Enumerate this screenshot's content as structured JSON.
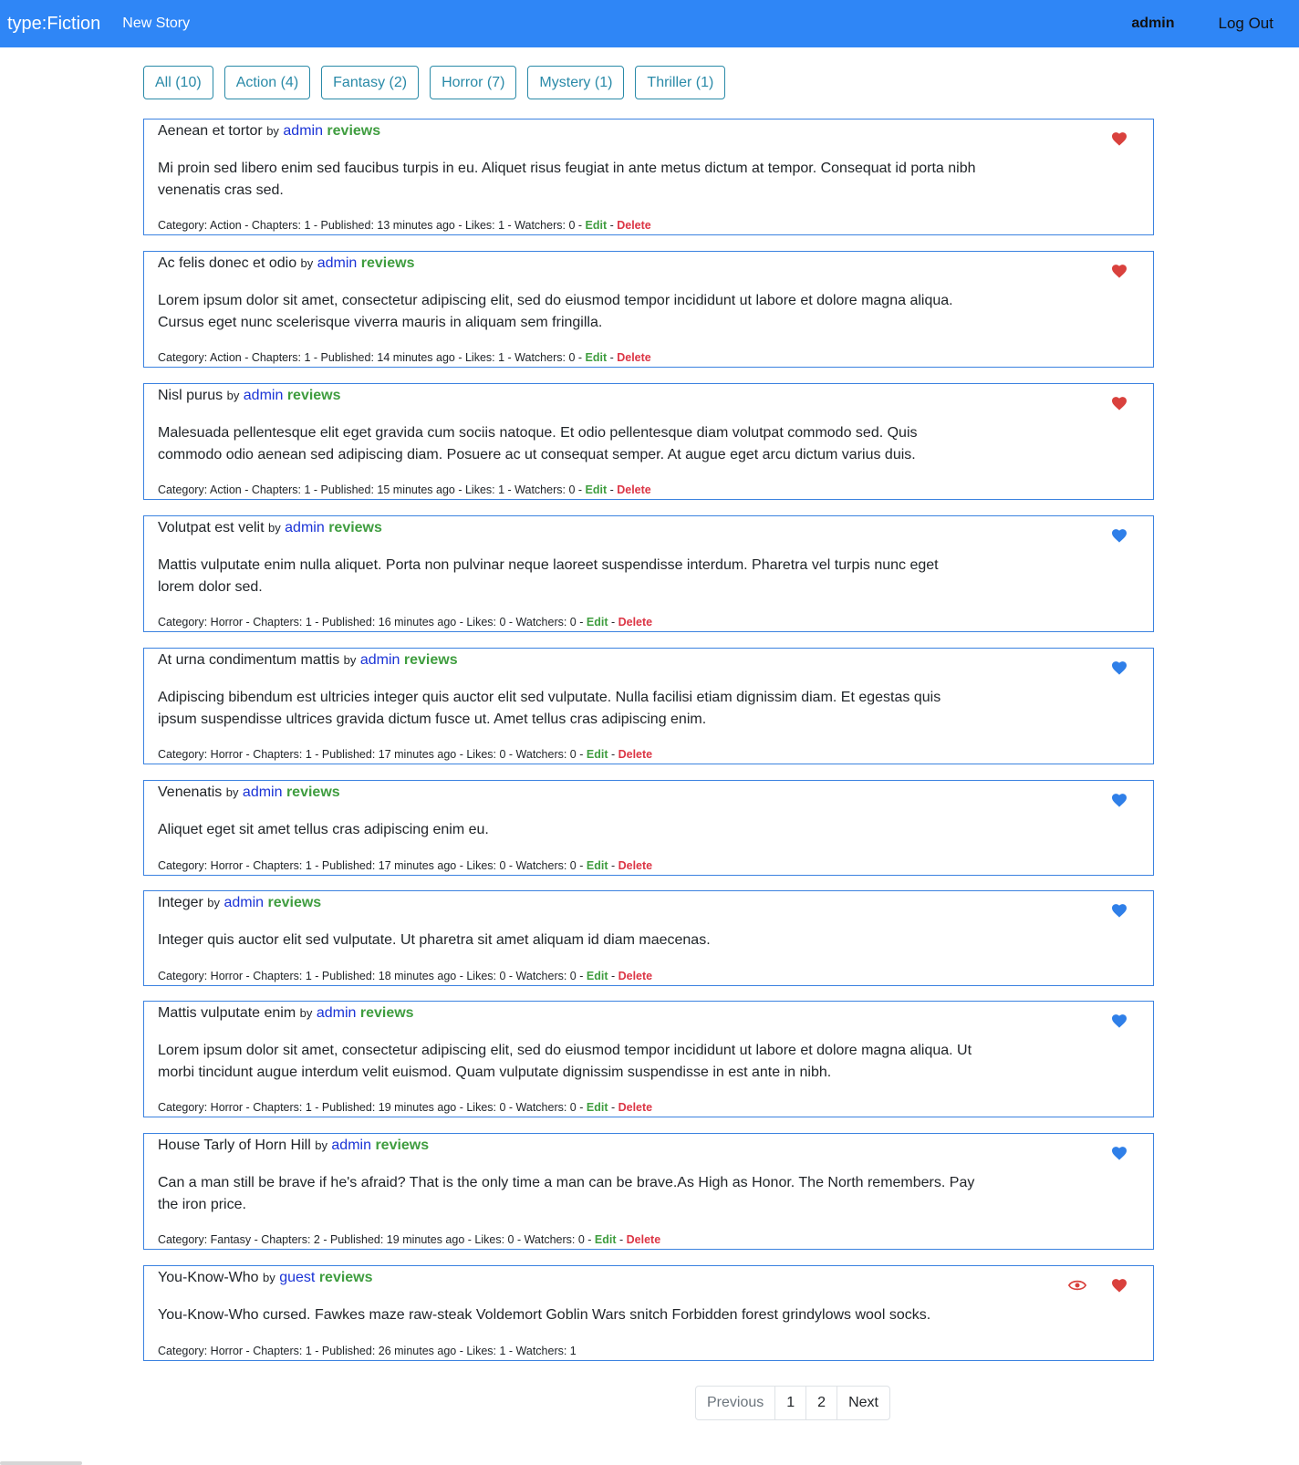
{
  "nav": {
    "brand": "type:Fiction",
    "new_story": "New Story",
    "user": "admin",
    "logout": "Log Out"
  },
  "filters": [
    "All (10)",
    "Action (4)",
    "Fantasy (2)",
    "Horror (7)",
    "Mystery (1)",
    "Thriller (1)"
  ],
  "labels": {
    "by": "by",
    "reviews": "reviews",
    "edit": "Edit",
    "delete": "Delete"
  },
  "colors": {
    "navbar": "#2f86f6",
    "heart_liked": "#d9413d",
    "heart_unliked": "#2f7fe8",
    "eye_watched": "#d9413d"
  },
  "stories": [
    {
      "title": "Aenean et tortor",
      "author": "admin",
      "desc": "Mi proin sed libero enim sed faucibus turpis in eu. Aliquet risus feugiat in ante metus dictum at tempor. Consequat id porta nibh venenatis cras sed.",
      "meta": "Category: Action - Chapters: 1 - Published: 13 minutes ago - Likes: 1 - Watchers: 0",
      "liked": true,
      "watched": false,
      "editable": true
    },
    {
      "title": "Ac felis donec et odio",
      "author": "admin",
      "desc": "Lorem ipsum dolor sit amet, consectetur adipiscing elit, sed do eiusmod tempor incididunt ut labore et dolore magna aliqua. Cursus eget nunc scelerisque viverra mauris in aliquam sem fringilla.",
      "meta": "Category: Action - Chapters: 1 - Published: 14 minutes ago - Likes: 1 - Watchers: 0",
      "liked": true,
      "watched": false,
      "editable": true
    },
    {
      "title": "Nisl purus",
      "author": "admin",
      "desc": "Malesuada pellentesque elit eget gravida cum sociis natoque. Et odio pellentesque diam volutpat commodo sed. Quis commodo odio aenean sed adipiscing diam. Posuere ac ut consequat semper. At augue eget arcu dictum varius duis.",
      "meta": "Category: Action - Chapters: 1 - Published: 15 minutes ago - Likes: 1 - Watchers: 0",
      "liked": true,
      "watched": false,
      "editable": true
    },
    {
      "title": "Volutpat est velit",
      "author": "admin",
      "desc": "Mattis vulputate enim nulla aliquet. Porta non pulvinar neque laoreet suspendisse interdum. Pharetra vel turpis nunc eget lorem dolor sed.",
      "meta": "Category: Horror - Chapters: 1 - Published: 16 minutes ago - Likes: 0 - Watchers: 0",
      "liked": false,
      "watched": false,
      "editable": true
    },
    {
      "title": "At urna condimentum mattis",
      "author": "admin",
      "desc": "Adipiscing bibendum est ultricies integer quis auctor elit sed vulputate. Nulla facilisi etiam dignissim diam. Et egestas quis ipsum suspendisse ultrices gravida dictum fusce ut. Amet tellus cras adipiscing enim.",
      "meta": "Category: Horror - Chapters: 1 - Published: 17 minutes ago - Likes: 0 - Watchers: 0",
      "liked": false,
      "watched": false,
      "editable": true
    },
    {
      "title": "Venenatis",
      "author": "admin",
      "desc": "Aliquet eget sit amet tellus cras adipiscing enim eu.",
      "meta": "Category: Horror - Chapters: 1 - Published: 17 minutes ago - Likes: 0 - Watchers: 0",
      "liked": false,
      "watched": false,
      "editable": true
    },
    {
      "title": "Integer",
      "author": "admin",
      "desc": "Integer quis auctor elit sed vulputate. Ut pharetra sit amet aliquam id diam maecenas.",
      "meta": "Category: Horror - Chapters: 1 - Published: 18 minutes ago - Likes: 0 - Watchers: 0",
      "liked": false,
      "watched": false,
      "editable": true
    },
    {
      "title": "Mattis vulputate enim",
      "author": "admin",
      "desc": "Lorem ipsum dolor sit amet, consectetur adipiscing elit, sed do eiusmod tempor incididunt ut labore et dolore magna aliqua. Ut morbi tincidunt augue interdum velit euismod. Quam vulputate dignissim suspendisse in est ante in nibh.",
      "meta": "Category: Horror - Chapters: 1 - Published: 19 minutes ago - Likes: 0 - Watchers: 0",
      "liked": false,
      "watched": false,
      "editable": true
    },
    {
      "title": "House Tarly of Horn Hill",
      "author": "admin",
      "desc": "Can a man still be brave if he's afraid? That is the only time a man can be brave.As High as Honor. The North remembers. Pay the iron price.",
      "meta": "Category: Fantasy - Chapters: 2 - Published: 19 minutes ago - Likes: 0 - Watchers: 0",
      "liked": false,
      "watched": false,
      "editable": true
    },
    {
      "title": "You-Know-Who",
      "author": "guest",
      "desc": "You-Know-Who cursed. Fawkes maze raw-steak Voldemort Goblin Wars snitch Forbidden forest grindylows wool socks.",
      "meta": "Category: Horror - Chapters: 1 - Published: 26 minutes ago - Likes: 1 - Watchers: 1",
      "liked": true,
      "watched": true,
      "editable": false
    }
  ],
  "pagination": [
    "Previous",
    "1",
    "2",
    "Next"
  ]
}
